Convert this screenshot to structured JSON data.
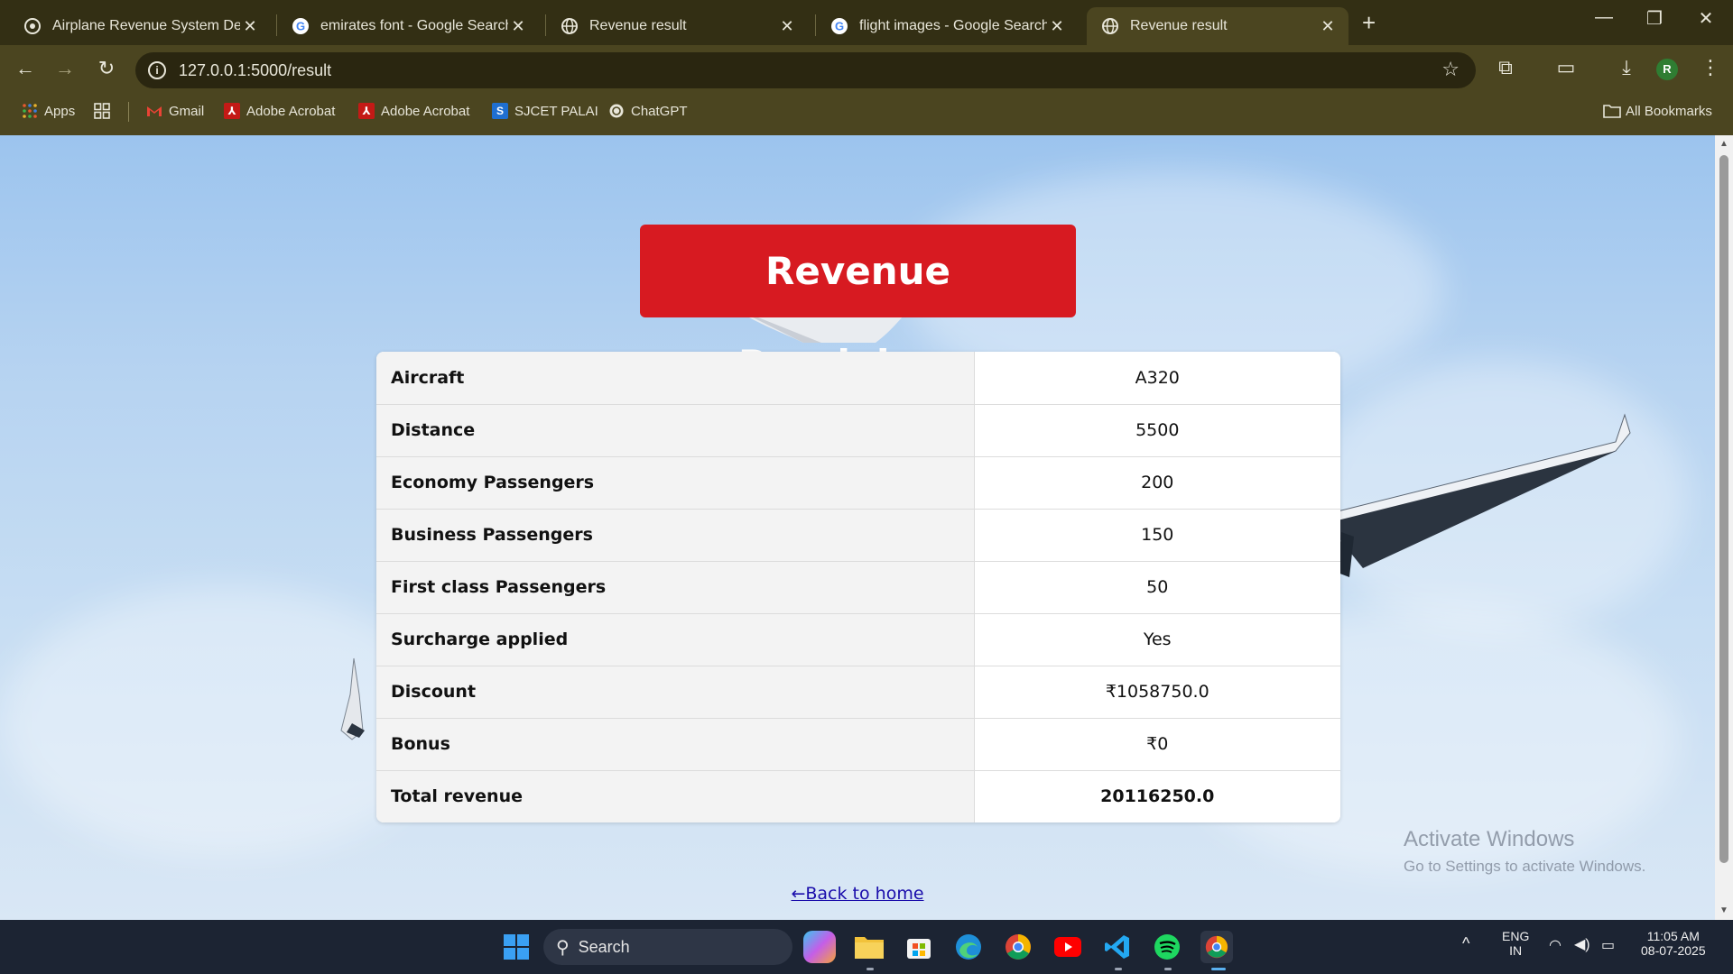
{
  "browser": {
    "tabs": [
      {
        "title": "Airplane Revenue System Devel",
        "favicon": "chatgpt-icon",
        "active": false
      },
      {
        "title": "emirates font - Google Search",
        "favicon": "google-icon",
        "active": false
      },
      {
        "title": "Revenue result",
        "favicon": "globe-icon",
        "active": false
      },
      {
        "title": "flight images - Google Search",
        "favicon": "google-icon",
        "active": false
      },
      {
        "title": "Revenue result",
        "favicon": "globe-icon",
        "active": true
      }
    ],
    "url": "127.0.0.1:5000/result",
    "profile_initial": "R",
    "bookmarks": [
      {
        "label": "Apps",
        "icon": "apps-grid-icon"
      },
      {
        "label": "",
        "icon": "tab-groups-icon"
      },
      {
        "label": "Gmail",
        "icon": "gmail-icon"
      },
      {
        "label": "Adobe Acrobat",
        "icon": "acrobat-icon"
      },
      {
        "label": "Adobe Acrobat",
        "icon": "acrobat-icon"
      },
      {
        "label": "SJCET PALAI",
        "icon": "sjcet-icon"
      },
      {
        "label": "ChatGPT",
        "icon": "chatgpt-icon"
      }
    ],
    "all_bookmarks": "All Bookmarks"
  },
  "page": {
    "heading": "Revenue Breakdown",
    "rows": [
      {
        "label": "Aircraft",
        "value": "A320"
      },
      {
        "label": "Distance",
        "value": "5500"
      },
      {
        "label": "Economy Passengers",
        "value": "200"
      },
      {
        "label": "Business Passengers",
        "value": "150"
      },
      {
        "label": "First class Passengers",
        "value": "50"
      },
      {
        "label": "Surcharge applied",
        "value": "Yes"
      },
      {
        "label": "Discount",
        "value": "₹1058750.0"
      },
      {
        "label": "Bonus",
        "value": "₹0"
      },
      {
        "label": "Total revenue",
        "value": "20116250.0"
      }
    ],
    "back_link": "←Back to home",
    "colors": {
      "heading_bg": "#d71a21",
      "link": "#1a0dab"
    }
  },
  "watermark": {
    "line1": "Activate Windows",
    "line2": "Go to Settings to activate Windows."
  },
  "taskbar": {
    "search_label": "Search",
    "language": "ENG",
    "region": "IN",
    "time": "11:05 AM",
    "date": "08-07-2025"
  }
}
